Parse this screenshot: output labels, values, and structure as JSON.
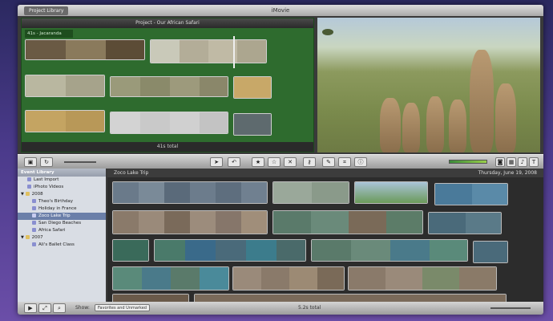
{
  "window": {
    "title": "iMovie",
    "library_tab": "Project Library"
  },
  "project": {
    "title": "Project - Our African Safari",
    "clip_label": "41s - Jacaranda",
    "total": "41s total"
  },
  "events": {
    "header": "Zoco Lake Trip",
    "date": "Thursday, June 19, 2008"
  },
  "sidebar": {
    "header": "Event Library",
    "items": [
      {
        "label": "Last Import",
        "level": 1,
        "icon_color": "#8a8fd0"
      },
      {
        "label": "iPhoto Videos",
        "level": 1,
        "icon_color": "#8a8fd0"
      },
      {
        "label": "2008",
        "level": 0,
        "icon_color": "#e0c060"
      },
      {
        "label": "Theo's Birthday",
        "level": 2,
        "icon_color": "#8a8fd0"
      },
      {
        "label": "Holiday in France",
        "level": 2,
        "icon_color": "#8a8fd0"
      },
      {
        "label": "Zoco Lake Trip",
        "level": 2,
        "icon_color": "#8a8fd0",
        "selected": true
      },
      {
        "label": "San Diego Beaches",
        "level": 2,
        "icon_color": "#8a8fd0"
      },
      {
        "label": "Africa Safari",
        "level": 2,
        "icon_color": "#8a8fd0"
      },
      {
        "label": "2007",
        "level": 0,
        "icon_color": "#e0c060"
      },
      {
        "label": "Ali's Ballet Class",
        "level": 2,
        "icon_color": "#8a8fd0"
      }
    ]
  },
  "toolbar": {
    "buttons": [
      "pointer-icon",
      "undo-icon",
      "star-icon",
      "unstar-icon",
      "reject-icon",
      "key-icon",
      "dropper-icon",
      "crop-icon",
      "info-icon"
    ]
  },
  "bottombar": {
    "show_label": "Show:",
    "filter": "Favorites and Unmarked",
    "total": "5.2s total"
  },
  "colors": {
    "project_bg": "#2e6b2e",
    "accent": "#6b7fa9"
  }
}
